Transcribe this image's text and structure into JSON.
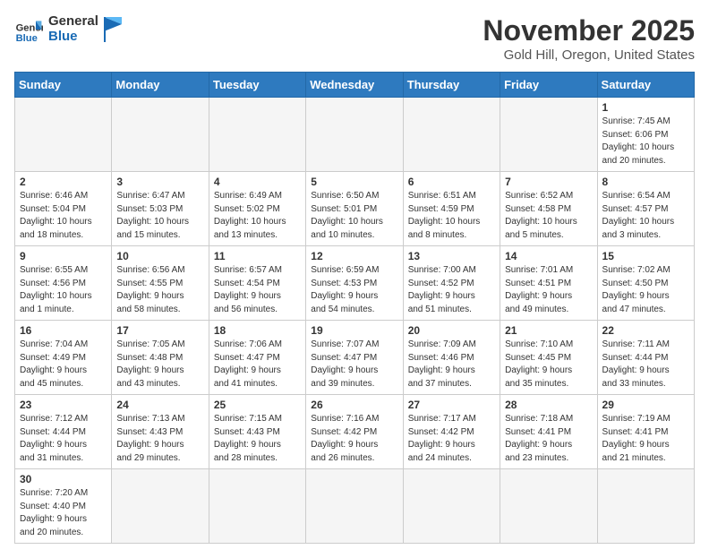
{
  "header": {
    "logo_general": "General",
    "logo_blue": "Blue",
    "month_title": "November 2025",
    "location": "Gold Hill, Oregon, United States"
  },
  "weekdays": [
    "Sunday",
    "Monday",
    "Tuesday",
    "Wednesday",
    "Thursday",
    "Friday",
    "Saturday"
  ],
  "weeks": [
    [
      {
        "day": "",
        "info": ""
      },
      {
        "day": "",
        "info": ""
      },
      {
        "day": "",
        "info": ""
      },
      {
        "day": "",
        "info": ""
      },
      {
        "day": "",
        "info": ""
      },
      {
        "day": "",
        "info": ""
      },
      {
        "day": "1",
        "info": "Sunrise: 7:45 AM\nSunset: 6:06 PM\nDaylight: 10 hours\nand 20 minutes."
      }
    ],
    [
      {
        "day": "2",
        "info": "Sunrise: 6:46 AM\nSunset: 5:04 PM\nDaylight: 10 hours\nand 18 minutes."
      },
      {
        "day": "3",
        "info": "Sunrise: 6:47 AM\nSunset: 5:03 PM\nDaylight: 10 hours\nand 15 minutes."
      },
      {
        "day": "4",
        "info": "Sunrise: 6:49 AM\nSunset: 5:02 PM\nDaylight: 10 hours\nand 13 minutes."
      },
      {
        "day": "5",
        "info": "Sunrise: 6:50 AM\nSunset: 5:01 PM\nDaylight: 10 hours\nand 10 minutes."
      },
      {
        "day": "6",
        "info": "Sunrise: 6:51 AM\nSunset: 4:59 PM\nDaylight: 10 hours\nand 8 minutes."
      },
      {
        "day": "7",
        "info": "Sunrise: 6:52 AM\nSunset: 4:58 PM\nDaylight: 10 hours\nand 5 minutes."
      },
      {
        "day": "8",
        "info": "Sunrise: 6:54 AM\nSunset: 4:57 PM\nDaylight: 10 hours\nand 3 minutes."
      }
    ],
    [
      {
        "day": "9",
        "info": "Sunrise: 6:55 AM\nSunset: 4:56 PM\nDaylight: 10 hours\nand 1 minute."
      },
      {
        "day": "10",
        "info": "Sunrise: 6:56 AM\nSunset: 4:55 PM\nDaylight: 9 hours\nand 58 minutes."
      },
      {
        "day": "11",
        "info": "Sunrise: 6:57 AM\nSunset: 4:54 PM\nDaylight: 9 hours\nand 56 minutes."
      },
      {
        "day": "12",
        "info": "Sunrise: 6:59 AM\nSunset: 4:53 PM\nDaylight: 9 hours\nand 54 minutes."
      },
      {
        "day": "13",
        "info": "Sunrise: 7:00 AM\nSunset: 4:52 PM\nDaylight: 9 hours\nand 51 minutes."
      },
      {
        "day": "14",
        "info": "Sunrise: 7:01 AM\nSunset: 4:51 PM\nDaylight: 9 hours\nand 49 minutes."
      },
      {
        "day": "15",
        "info": "Sunrise: 7:02 AM\nSunset: 4:50 PM\nDaylight: 9 hours\nand 47 minutes."
      }
    ],
    [
      {
        "day": "16",
        "info": "Sunrise: 7:04 AM\nSunset: 4:49 PM\nDaylight: 9 hours\nand 45 minutes."
      },
      {
        "day": "17",
        "info": "Sunrise: 7:05 AM\nSunset: 4:48 PM\nDaylight: 9 hours\nand 43 minutes."
      },
      {
        "day": "18",
        "info": "Sunrise: 7:06 AM\nSunset: 4:47 PM\nDaylight: 9 hours\nand 41 minutes."
      },
      {
        "day": "19",
        "info": "Sunrise: 7:07 AM\nSunset: 4:47 PM\nDaylight: 9 hours\nand 39 minutes."
      },
      {
        "day": "20",
        "info": "Sunrise: 7:09 AM\nSunset: 4:46 PM\nDaylight: 9 hours\nand 37 minutes."
      },
      {
        "day": "21",
        "info": "Sunrise: 7:10 AM\nSunset: 4:45 PM\nDaylight: 9 hours\nand 35 minutes."
      },
      {
        "day": "22",
        "info": "Sunrise: 7:11 AM\nSunset: 4:44 PM\nDaylight: 9 hours\nand 33 minutes."
      }
    ],
    [
      {
        "day": "23",
        "info": "Sunrise: 7:12 AM\nSunset: 4:44 PM\nDaylight: 9 hours\nand 31 minutes."
      },
      {
        "day": "24",
        "info": "Sunrise: 7:13 AM\nSunset: 4:43 PM\nDaylight: 9 hours\nand 29 minutes."
      },
      {
        "day": "25",
        "info": "Sunrise: 7:15 AM\nSunset: 4:43 PM\nDaylight: 9 hours\nand 28 minutes."
      },
      {
        "day": "26",
        "info": "Sunrise: 7:16 AM\nSunset: 4:42 PM\nDaylight: 9 hours\nand 26 minutes."
      },
      {
        "day": "27",
        "info": "Sunrise: 7:17 AM\nSunset: 4:42 PM\nDaylight: 9 hours\nand 24 minutes."
      },
      {
        "day": "28",
        "info": "Sunrise: 7:18 AM\nSunset: 4:41 PM\nDaylight: 9 hours\nand 23 minutes."
      },
      {
        "day": "29",
        "info": "Sunrise: 7:19 AM\nSunset: 4:41 PM\nDaylight: 9 hours\nand 21 minutes."
      }
    ],
    [
      {
        "day": "30",
        "info": "Sunrise: 7:20 AM\nSunset: 4:40 PM\nDaylight: 9 hours\nand 20 minutes."
      },
      {
        "day": "",
        "info": ""
      },
      {
        "day": "",
        "info": ""
      },
      {
        "day": "",
        "info": ""
      },
      {
        "day": "",
        "info": ""
      },
      {
        "day": "",
        "info": ""
      },
      {
        "day": "",
        "info": ""
      }
    ]
  ]
}
